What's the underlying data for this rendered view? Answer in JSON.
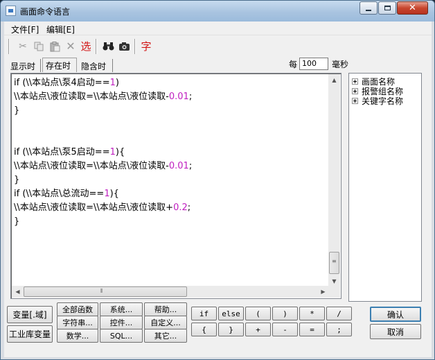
{
  "window": {
    "title": "画面命令语言"
  },
  "menu": {
    "file": "文件[F]",
    "edit": "编辑[E]"
  },
  "toolbar": {
    "select_label": "选",
    "font_label": "字"
  },
  "tabs": [
    "显示时",
    "存在时",
    "隐含时"
  ],
  "interval": {
    "prefix": "每",
    "value": "100",
    "unit": "毫秒"
  },
  "code_lines": [
    [
      "if (\\\\本站点\\泵4启动==",
      "1",
      ")"
    ],
    [
      "\\\\本站点\\液位读取=\\\\本站点\\液位读取-",
      "0.01",
      ";"
    ],
    [
      "}",
      "",
      ""
    ],
    [
      "",
      "",
      ""
    ],
    [
      "",
      "",
      ""
    ],
    [
      "if (\\\\本站点\\泵5启动==",
      "1",
      "){"
    ],
    [
      "\\\\本站点\\液位读取=\\\\本站点\\液位读取-",
      "0.01",
      ";"
    ],
    [
      "}",
      "",
      ""
    ],
    [
      "if (\\\\本站点\\总流动==",
      "1",
      "){"
    ],
    [
      "\\\\本站点\\液位读取=\\\\本站点\\液位读取+",
      "0.2",
      ";"
    ],
    [
      "}",
      "",
      ""
    ]
  ],
  "tree": [
    "画面名称",
    "报警组名称",
    "关键字名称"
  ],
  "var_buttons": {
    "variable": "变量[.域]",
    "industrial": "工业库变量"
  },
  "func_buttons": {
    "all": "全部函数",
    "system": "系统...",
    "help": "帮助...",
    "string": "字符串...",
    "control": "控件...",
    "custom": "自定义...",
    "math": "数学...",
    "sql": "SQL...",
    "other": "其它..."
  },
  "op_buttons": {
    "row1": [
      "if",
      "else",
      "(",
      ")",
      "*",
      "/"
    ],
    "row2": [
      "{",
      "}",
      "+",
      "-",
      "=",
      ";"
    ]
  },
  "dialog": {
    "ok": "确认",
    "cancel": "取消"
  }
}
